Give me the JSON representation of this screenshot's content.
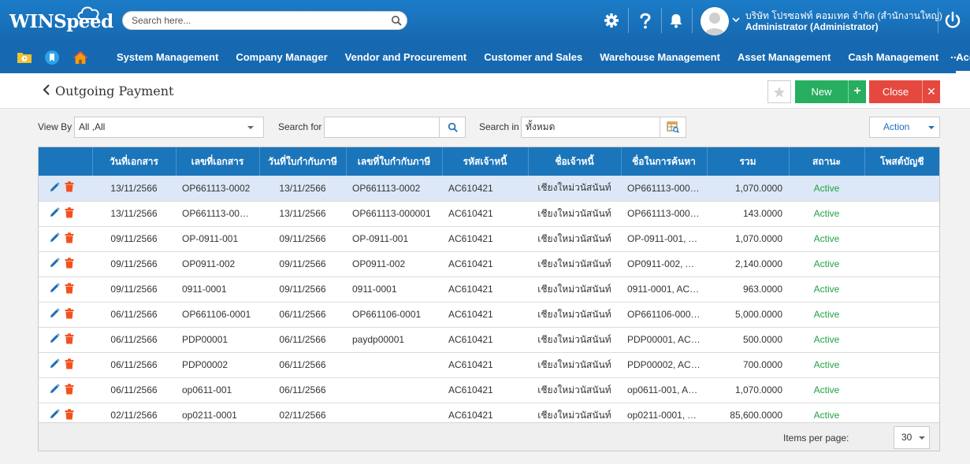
{
  "app": {
    "logo_text": "WINSpeed",
    "search_placeholder": "Search here...",
    "company": "บริษัท โปรซอฟท์ คอมเทค จำกัด (สำนักงานใหญ่)",
    "user_role": "Administrator (Administrator)"
  },
  "nav": {
    "items": [
      {
        "label": "System Management"
      },
      {
        "label": "Company Manager"
      },
      {
        "label": "Vendor and Procurement"
      },
      {
        "label": "Customer and Sales"
      },
      {
        "label": "Warehouse Management"
      },
      {
        "label": "Asset Management"
      },
      {
        "label": "Cash Management"
      },
      {
        "label": "Accounting"
      }
    ],
    "active": "Accounting",
    "more_label": "..."
  },
  "page": {
    "title": "Outgoing Payment",
    "new_label": "New",
    "new_plus": "+",
    "close_label": "Close",
    "close_x": "✕"
  },
  "filters": {
    "view_by_label": "View By",
    "view_by_value": "All ,All",
    "search_for_label": "Search for",
    "search_for_value": "",
    "search_in_label": "Search in",
    "search_in_value": "ทั้งหมด",
    "action_label": "Action"
  },
  "table": {
    "columns": [
      "",
      "วันที่เอกสาร",
      "เลขที่เอกสาร",
      "วันที่ใบกำกับภาษี",
      "เลขที่ใบกำกับภาษี",
      "รหัสเจ้าหนี้",
      "ชื่อเจ้าหนี้",
      "ชื่อในการค้นหา",
      "รวม",
      "สถานะ",
      "โพสต์บัญชี"
    ],
    "rows": [
      {
        "doc_date": "13/11/2566",
        "doc_no": "OP661113-0002",
        "tax_date": "13/11/2566",
        "tax_no": "OP661113-0002",
        "vendor_code": "AC610421",
        "vendor_name": "เชียงใหม่วนัสนันท์",
        "search_name": "OP661113-0002,...",
        "total": "1,070.0000",
        "status": "Active",
        "posted": ""
      },
      {
        "doc_date": "13/11/2566",
        "doc_no": "OP661113-0000...",
        "tax_date": "13/11/2566",
        "tax_no": "OP661113-000001",
        "vendor_code": "AC610421",
        "vendor_name": "เชียงใหม่วนัสนันท์",
        "search_name": "OP661113-00000...",
        "total": "143.0000",
        "status": "Active",
        "posted": ""
      },
      {
        "doc_date": "09/11/2566",
        "doc_no": "OP-0911-001",
        "tax_date": "09/11/2566",
        "tax_no": "OP-0911-001",
        "vendor_code": "AC610421",
        "vendor_name": "เชียงใหม่วนัสนันท์",
        "search_name": "OP-0911-001, AC...",
        "total": "1,070.0000",
        "status": "Active",
        "posted": ""
      },
      {
        "doc_date": "09/11/2566",
        "doc_no": "OP0911-002",
        "tax_date": "09/11/2566",
        "tax_no": "OP0911-002",
        "vendor_code": "AC610421",
        "vendor_name": "เชียงใหม่วนัสนันท์",
        "search_name": "OP0911-002, AC...",
        "total": "2,140.0000",
        "status": "Active",
        "posted": ""
      },
      {
        "doc_date": "09/11/2566",
        "doc_no": "0911-0001",
        "tax_date": "09/11/2566",
        "tax_no": "0911-0001",
        "vendor_code": "AC610421",
        "vendor_name": "เชียงใหม่วนัสนันท์",
        "search_name": "0911-0001, AC61...",
        "total": "963.0000",
        "status": "Active",
        "posted": ""
      },
      {
        "doc_date": "06/11/2566",
        "doc_no": "OP661106-0001",
        "tax_date": "06/11/2566",
        "tax_no": "OP661106-0001",
        "vendor_code": "AC610421",
        "vendor_name": "เชียงใหม่วนัสนันท์",
        "search_name": "OP661106-0001,...",
        "total": "5,000.0000",
        "status": "Active",
        "posted": ""
      },
      {
        "doc_date": "06/11/2566",
        "doc_no": "PDP00001",
        "tax_date": "06/11/2566",
        "tax_no": "paydp00001",
        "vendor_code": "AC610421",
        "vendor_name": "เชียงใหม่วนัสนันท์",
        "search_name": "PDP00001, AC61...",
        "total": "500.0000",
        "status": "Active",
        "posted": ""
      },
      {
        "doc_date": "06/11/2566",
        "doc_no": "PDP00002",
        "tax_date": "06/11/2566",
        "tax_no": "",
        "vendor_code": "AC610421",
        "vendor_name": "เชียงใหม่วนัสนันท์",
        "search_name": "PDP00002, AC61...",
        "total": "700.0000",
        "status": "Active",
        "posted": ""
      },
      {
        "doc_date": "06/11/2566",
        "doc_no": "op0611-001",
        "tax_date": "06/11/2566",
        "tax_no": "",
        "vendor_code": "AC610421",
        "vendor_name": "เชียงใหม่วนัสนันท์",
        "search_name": "op0611-001, AC6...",
        "total": "1,070.0000",
        "status": "Active",
        "posted": ""
      },
      {
        "doc_date": "02/11/2566",
        "doc_no": "op0211-0001",
        "tax_date": "02/11/2566",
        "tax_no": "",
        "vendor_code": "AC610421",
        "vendor_name": "เชียงใหม่วนัสนันท์",
        "search_name": "op0211-0001, AC...",
        "total": "85,600.0000",
        "status": "Active",
        "posted": ""
      }
    ],
    "selected_row": 0
  },
  "pager": {
    "items_per_page_label": "Items per page:",
    "items_per_page": "30"
  },
  "colors": {
    "header_blue": "#1b75bb",
    "status_green": "#22a145",
    "new_green": "#27ae60",
    "close_red": "#e5483f",
    "delete_orange": "#f4511e"
  }
}
